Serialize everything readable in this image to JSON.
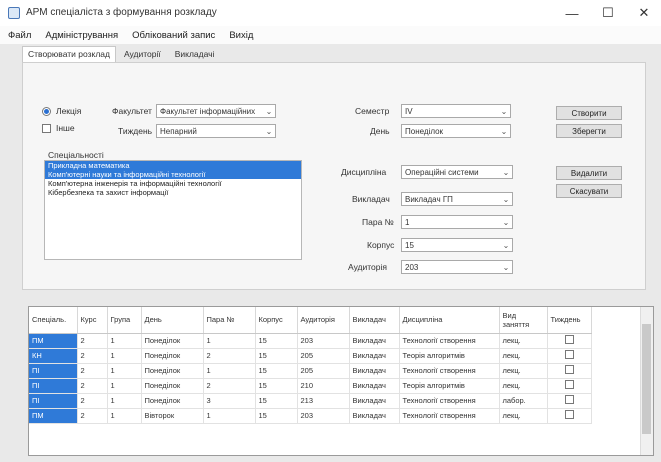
{
  "window": {
    "title": "АРМ спеціаліста з формування розкладу",
    "minimize": "—",
    "maximize": "☐",
    "close": "✕"
  },
  "menu": [
    "Файл",
    "Адміністрування",
    "Облікований запис",
    "Вихід"
  ],
  "tabs": [
    "Створювати розклад",
    "Аудиторії",
    "Викладачі"
  ],
  "form": {
    "radio_lecture": "Лекція",
    "check_practice": "Інше",
    "faculty_label": "Факультет",
    "faculty_value": "Факультет інформаційних",
    "week_label": "Тиждень",
    "week_value": "Непарний",
    "semester_label": "Семестр",
    "semester_value": "IV",
    "day_label": "День",
    "day_value": "Понеділок",
    "discipline_label": "Дисципліна",
    "discipline_value": "Операційні системи",
    "teacher_label": "Викладач",
    "teacher_value": "Викладач ГП",
    "pair_label": "Пара №",
    "pair_value": "1",
    "building_label": "Корпус",
    "building_value": "15",
    "auditorium_label": "Аудиторія",
    "auditorium_value": "203",
    "btn_create": "Створити",
    "btn_save": "Зберегти",
    "btn_delete": "Видалити",
    "btn_cancel": "Скасувати"
  },
  "specialties": {
    "title": "Спеціальності",
    "items": [
      {
        "label": "Прикладна математика",
        "selected": true
      },
      {
        "label": "Комп'ютерні науки та інформаційні технології",
        "selected": true
      },
      {
        "label": "Комп'ютерна інженерія та інформаційні технології",
        "selected": false
      },
      {
        "label": "Кібербезпека та захист інформації",
        "selected": false
      }
    ]
  },
  "grid": {
    "columns": [
      "Спеціаль.",
      "Курс",
      "Група",
      "День",
      "Пара №",
      "Корпус",
      "Аудиторія",
      "Викладач",
      "Дисципліна",
      "Вид заняття",
      "Тиждень"
    ],
    "rows": [
      [
        "ПМ",
        "2",
        "1",
        "Понеділок",
        "1",
        "15",
        "203",
        "Викладач",
        "Технології створення",
        "лекц.",
        ""
      ],
      [
        "КН",
        "2",
        "1",
        "Понеділок",
        "2",
        "15",
        "205",
        "Викладач",
        "Теорія алгоритмів",
        "лекц.",
        ""
      ],
      [
        "ПІ",
        "2",
        "1",
        "Понеділок",
        "1",
        "15",
        "205",
        "Викладач",
        "Технології створення",
        "лекц.",
        ""
      ],
      [
        "ПІ",
        "2",
        "1",
        "Понеділок",
        "2",
        "15",
        "210",
        "Викладач",
        "Теорія алгоритмів",
        "лекц.",
        ""
      ],
      [
        "ПІ",
        "2",
        "1",
        "Понеділок",
        "3",
        "15",
        "213",
        "Викладач",
        "Технології створення",
        "лабор.",
        ""
      ],
      [
        "ПМ",
        "2",
        "1",
        "Вівторок",
        "1",
        "15",
        "203",
        "Викладач",
        "Технології створення",
        "лекц.",
        ""
      ]
    ]
  }
}
